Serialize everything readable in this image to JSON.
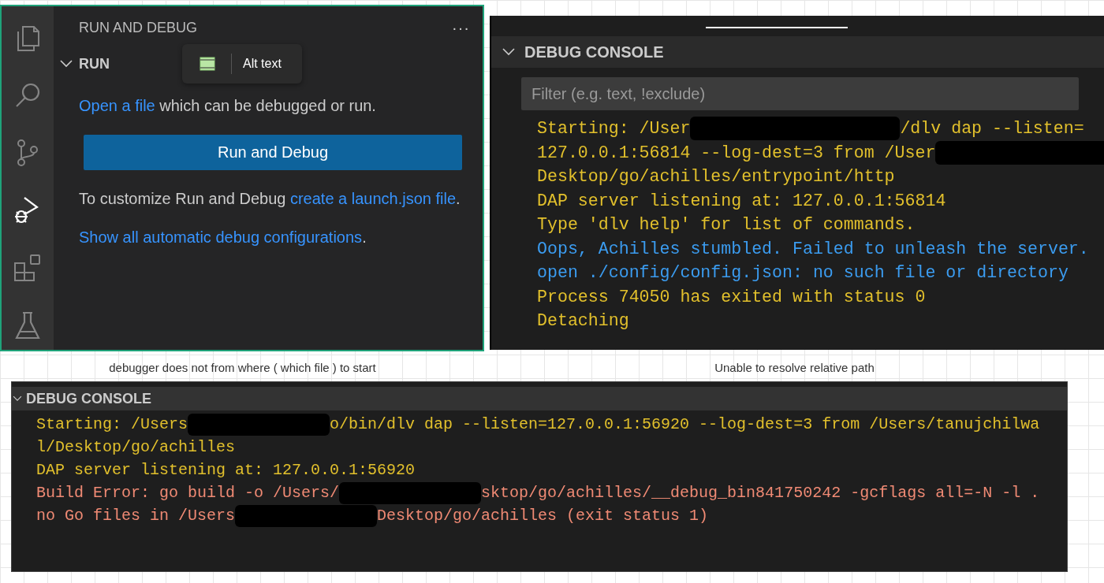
{
  "run_panel": {
    "activity_bar": [
      {
        "kind": "files",
        "selected": false
      },
      {
        "kind": "search",
        "selected": false
      },
      {
        "kind": "source-control",
        "selected": false
      },
      {
        "kind": "run-debug",
        "selected": true
      },
      {
        "kind": "extensions",
        "selected": false
      },
      {
        "kind": "testing",
        "selected": false
      }
    ],
    "title": "RUN AND DEBUG",
    "more": "···",
    "section": {
      "label": "RUN",
      "expanded": true
    },
    "tooltip": {
      "label": "Alt text"
    },
    "paragraphs": [
      [
        {
          "text": "Open a file",
          "link": true
        },
        {
          "text": " which can be debugged or run.",
          "link": false
        }
      ],
      {
        "button": "Run and Debug"
      },
      [
        {
          "text": "To customize Run and Debug ",
          "link": false
        },
        {
          "text": "create a launch.json ",
          "link": true
        },
        {
          "text": "file",
          "link": true
        },
        {
          "text": ".",
          "link": false
        }
      ],
      [
        {
          "text": "Show all automatic debug configurations",
          "link": true
        },
        {
          "text": ".",
          "link": false
        }
      ]
    ]
  },
  "captions": [
    "debugger does not from where ( which file ) to start",
    "Unable to resolve relative path"
  ],
  "consoles": [
    {
      "title": "DEBUG CONSOLE",
      "expanded": true,
      "filter": {
        "placeholder": "Filter (e.g. text, !exclude)"
      },
      "lines": [
        {
          "color": "#e2c02c",
          "segments": [
            {
              "kind": "text",
              "text": "Starting: /User"
            },
            {
              "kind": "redacted"
            },
            {
              "kind": "text",
              "text": "/dlv dap --listen="
            }
          ]
        },
        {
          "color": "#e2c02c",
          "segments": [
            {
              "kind": "text",
              "text": "127.0.0.1:56814 --log-dest=3 from /User"
            },
            {
              "kind": "redacted"
            }
          ]
        },
        {
          "color": "#e2c02c",
          "segments": [
            {
              "kind": "text",
              "text": "Desktop/go/achilles/entrypoint/http"
            }
          ]
        },
        {
          "color": "#e2c02c",
          "segments": [
            {
              "kind": "text",
              "text": "DAP server listening at: 127.0.0.1:56814"
            }
          ]
        },
        {
          "color": "#e2c02c",
          "segments": [
            {
              "kind": "text",
              "text": "Type 'dlv help' for list of commands."
            }
          ]
        },
        {
          "color": "#3b9cf0",
          "segments": [
            {
              "kind": "text",
              "text": "Oops, Achilles stumbled. Failed to unleash the server."
            }
          ]
        },
        {
          "color": "#3b9cf0",
          "segments": [
            {
              "kind": "text",
              "text": "open ./config/config.json: no such file or directory"
            }
          ]
        },
        {
          "color": "#e2c02c",
          "segments": [
            {
              "kind": "text",
              "text": "Process 74050 has exited with status 0"
            }
          ]
        },
        {
          "color": "#e2c02c",
          "segments": [
            {
              "kind": "text",
              "text": "Detaching"
            }
          ]
        }
      ]
    },
    {
      "title": "DEBUG CONSOLE",
      "expanded": true,
      "lines": [
        {
          "color": "#e2c02c",
          "segments": [
            {
              "kind": "text",
              "text": "Starting: /Users"
            },
            {
              "kind": "redacted"
            },
            {
              "kind": "text",
              "text": "o/bin/dlv dap --listen=127.0.0.1:56920 --log-dest=3 from /Users/tanujchilwa"
            }
          ]
        },
        {
          "color": "#e2c02c",
          "segments": [
            {
              "kind": "text",
              "text": "l/Desktop/go/achilles"
            }
          ]
        },
        {
          "color": "#e2c02c",
          "segments": [
            {
              "kind": "text",
              "text": "DAP server listening at: 127.0.0.1:56920"
            }
          ]
        },
        {
          "color": "#f08a74",
          "segments": [
            {
              "kind": "text",
              "text": "Build Error: go build -o /Users/"
            },
            {
              "kind": "redacted"
            },
            {
              "kind": "text",
              "text": "sktop/go/achilles/__debug_bin841750242 -gcflags all=-N -l ."
            }
          ]
        },
        {
          "color": "#f08a74",
          "segments": [
            {
              "kind": "text",
              "text": "no Go files in /Users"
            },
            {
              "kind": "redacted"
            },
            {
              "kind": "text",
              "text": "Desktop/go/achilles (exit status 1)"
            }
          ]
        }
      ]
    }
  ]
}
